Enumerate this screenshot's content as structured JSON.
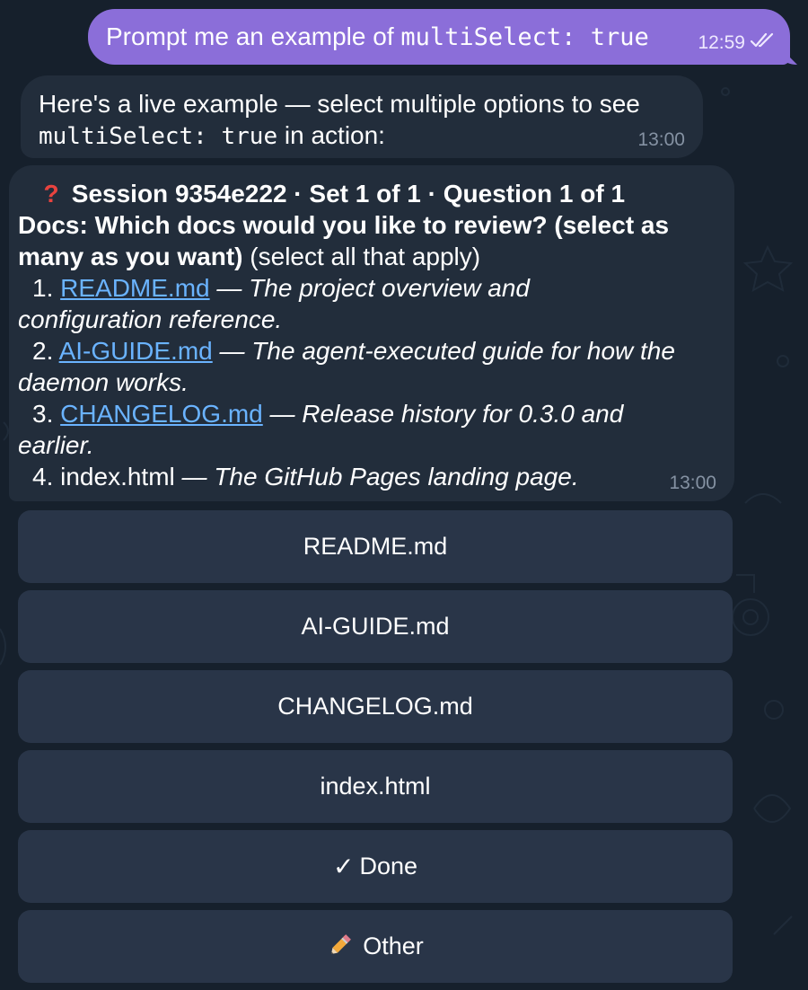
{
  "colors": {
    "background": "#16202c",
    "outgoing_bubble": "#8b6ed9",
    "incoming_bubble": "#222d3b",
    "button": "#293548",
    "link": "#6ab3ff",
    "timestamp": "#8592a3",
    "question_mark": "#e8433f"
  },
  "outgoing": {
    "text_before": "Prompt me an example of ",
    "code": "multiSelect: true",
    "time": "12:59",
    "status_icon": "double-check-icon"
  },
  "reply": {
    "line1": "Here's a live example — select multiple options to see",
    "code": "multiSelect: true",
    "line2_after": " in action:",
    "time": "13:00"
  },
  "question": {
    "icon": "question-mark-icon",
    "header": "Session 9354e222 · Set 1 of 1 · Question 1 of 1",
    "prompt_line1": "Docs: Which docs would you like to review? (select as",
    "prompt_line2_bold": "many as you want)",
    "prompt_line2_rest": " (select all that apply)",
    "options": [
      {
        "num": "1.",
        "link": "README.md",
        "desc_line1": " — The project overview and",
        "desc_line2": "configuration reference."
      },
      {
        "num": "2.",
        "link": "AI-GUIDE.md",
        "desc_line1": " — The agent-executed guide for how the",
        "desc_line2": "daemon works."
      },
      {
        "num": "3.",
        "link": "CHANGELOG.md",
        "desc_line1": " — Release history for 0.3.0 and",
        "desc_line2": "earlier."
      },
      {
        "num": "4.",
        "plain": "index.html",
        "desc_line1": " — The GitHub Pages landing page."
      }
    ],
    "time": "13:00"
  },
  "buttons": [
    {
      "label": "README.md"
    },
    {
      "label": "AI-GUIDE.md"
    },
    {
      "label": "CHANGELOG.md"
    },
    {
      "label": "index.html"
    },
    {
      "icon_char": "✓",
      "icon": "check-icon",
      "label": "Done"
    },
    {
      "icon_char": "✏",
      "icon": "pencil-icon",
      "label": "Other"
    }
  ]
}
